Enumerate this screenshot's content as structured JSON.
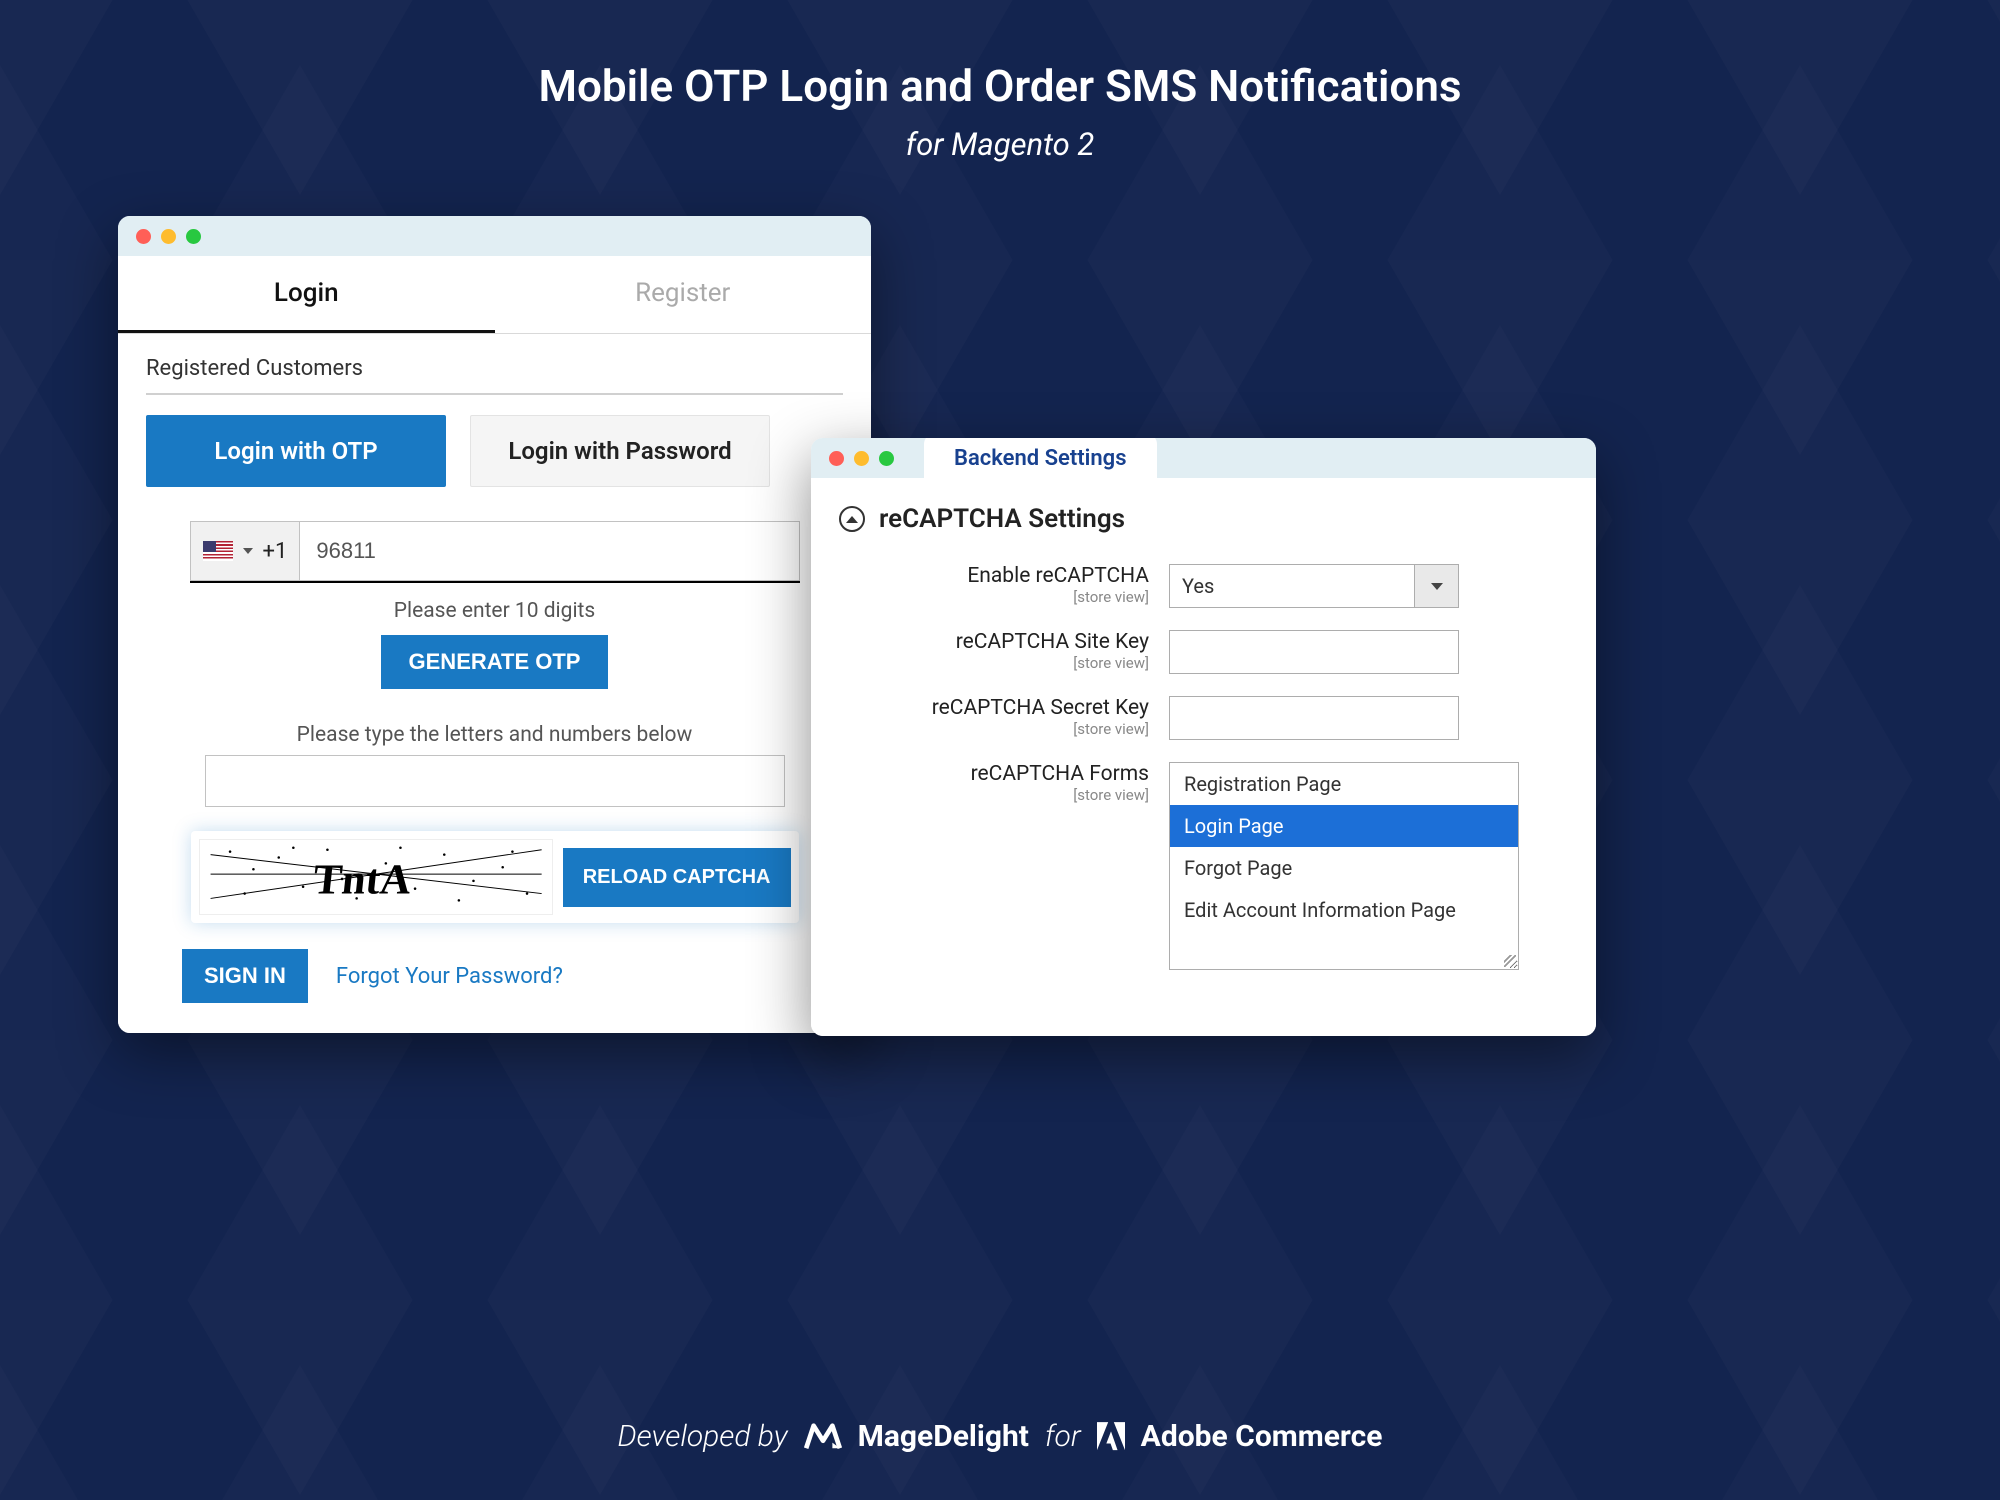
{
  "header": {
    "title": "Mobile OTP Login and Order SMS Notifications",
    "subtitle": "for Magento 2"
  },
  "login": {
    "tabs": {
      "login": "Login",
      "register": "Register"
    },
    "registered": "Registered Customers",
    "methods": {
      "otp": "Login with OTP",
      "password": "Login with Password"
    },
    "phone": {
      "dial_code": "+1",
      "value": "96811"
    },
    "hint": "Please enter 10 digits",
    "generate_otp": "GENERATE OTP",
    "captcha_label": "Please type the letters and numbers below",
    "captcha_text": "TntA",
    "reload_captcha": "RELOAD CAPTCHA",
    "sign_in": "SIGN IN",
    "forgot": "Forgot Your Password?"
  },
  "backend": {
    "window_tab": "Backend Settings",
    "section_title": "reCAPTCHA Settings",
    "scope": "[store view]",
    "fields": {
      "enable": {
        "label": "Enable reCAPTCHA",
        "value": "Yes"
      },
      "site_key": {
        "label": "reCAPTCHA Site Key"
      },
      "secret_key": {
        "label": "reCAPTCHA Secret Key"
      },
      "forms": {
        "label": "reCAPTCHA Forms",
        "options": [
          "Registration Page",
          "Login Page",
          "Forgot Page",
          "Edit Account Information Page"
        ],
        "selected": "Login Page"
      }
    }
  },
  "footer": {
    "developed_by": "Developed by",
    "brand": "MageDelight",
    "for": "for",
    "adobe": "Adobe Commerce"
  }
}
